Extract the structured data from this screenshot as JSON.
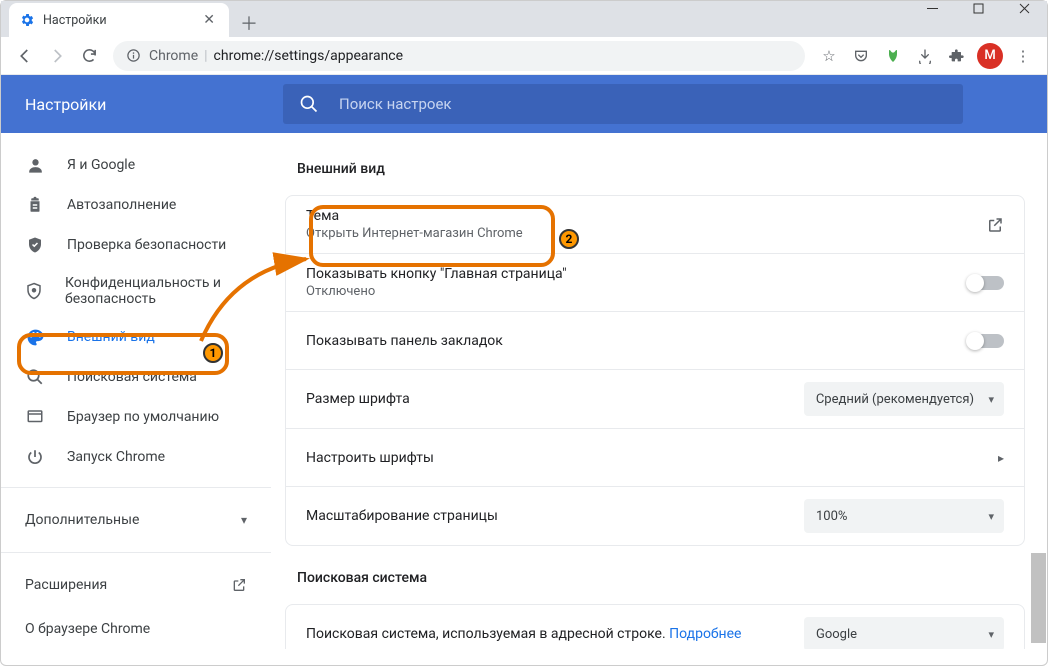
{
  "window": {
    "tab_title": "Настройки",
    "url_label": "Chrome",
    "url_path": "chrome://settings/appearance",
    "avatar_letter": "M"
  },
  "header": {
    "title": "Настройки",
    "search_placeholder": "Поиск настроек"
  },
  "sidebar": {
    "items": [
      {
        "label": "Я и Google",
        "icon": "person"
      },
      {
        "label": "Автозаполнение",
        "icon": "clipboard"
      },
      {
        "label": "Проверка безопасности",
        "icon": "shield-check"
      },
      {
        "label": "Конфиденциальность и безопасность",
        "icon": "shield"
      },
      {
        "label": "Внешний вид",
        "icon": "palette"
      },
      {
        "label": "Поисковая система",
        "icon": "search"
      },
      {
        "label": "Браузер по умолчанию",
        "icon": "browser"
      },
      {
        "label": "Запуск Chrome",
        "icon": "power"
      }
    ],
    "more": "Дополнительные",
    "extensions": "Расширения",
    "about": "О браузере Chrome"
  },
  "appearance": {
    "section": "Внешний вид",
    "theme_title": "Тема",
    "theme_sub": "Открыть Интернет-магазин Chrome",
    "home_title": "Показывать кнопку \"Главная страница\"",
    "home_sub": "Отключено",
    "bookmarks_title": "Показывать панель закладок",
    "fontsize_title": "Размер шрифта",
    "fontsize_value": "Средний (рекомендуется)",
    "customfonts_title": "Настроить шрифты",
    "zoom_title": "Масштабирование страницы",
    "zoom_value": "100%"
  },
  "search": {
    "section": "Поисковая система",
    "engine_text": "Поисковая система, используемая в адресной строке.",
    "engine_more": "Подробнее",
    "engine_value": "Google"
  },
  "annotations": {
    "badge1": "1",
    "badge2": "2"
  }
}
